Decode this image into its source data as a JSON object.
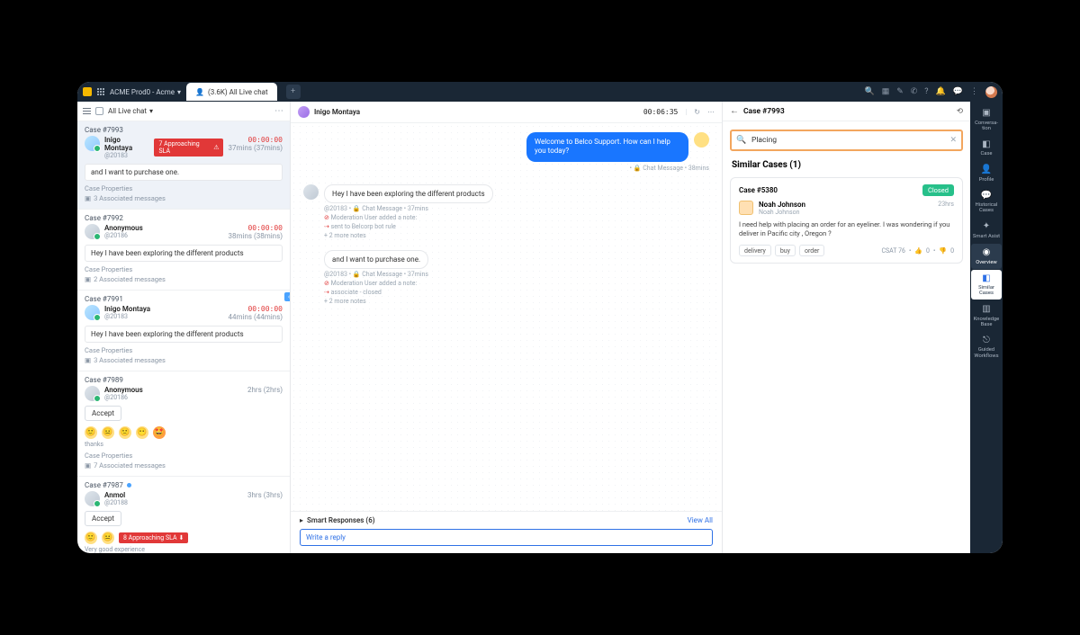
{
  "topbar": {
    "workspace": "ACME Prod0 - Acme",
    "tab_label": "(3.6K) All Live chat"
  },
  "list": {
    "title": "All Live chat",
    "cases": [
      {
        "id": "Case #7993",
        "name": "Inigo Montaya",
        "handle": "@20183",
        "sla": "7 Approaching SLA",
        "timer": "00:00:00",
        "time": "37mins (37mins)",
        "preview": "and I want to purchase one.",
        "props": "Case Properties",
        "assoc": "3 Associated messages"
      },
      {
        "id": "Case #7992",
        "name": "Anonymous",
        "handle": "@20186",
        "timer": "00:00:00",
        "time": "38mins (38mins)",
        "preview": "Hey I have been exploring the different products",
        "props": "Case Properties",
        "assoc": "2 Associated messages"
      },
      {
        "id": "Case #7991",
        "name": "Inigo Montaya",
        "handle": "@20183",
        "timer": "00:00:00",
        "time": "44mins (44mins)",
        "preview": "Hey I have been exploring the different products",
        "props": "Case Properties",
        "assoc": "3 Associated messages"
      },
      {
        "id": "Case #7989",
        "name": "Anonymous",
        "handle": "@20186",
        "time": "2hrs (2hrs)",
        "accept": "Accept",
        "thanks": "thanks",
        "props": "Case Properties",
        "assoc": "7 Associated messages"
      },
      {
        "id": "Case #7987",
        "name": "Anmol",
        "handle": "@20188",
        "time": "3hrs (3hrs)",
        "accept": "Accept",
        "sla2": "8 Approaching SLA",
        "trail": "Very good experience"
      }
    ]
  },
  "chat": {
    "name": "Inigo Montaya",
    "timer": "00:06:35",
    "out": "Welcome to Belco Support. How can I help you today?",
    "out_meta": "• 🔒 Chat Message • 38mins",
    "in1": "Hey I have been exploring the different products",
    "in1_meta1": "@20183 • 🔒 Chat Message • 37mins",
    "in1_meta2": "Moderation User added a note:",
    "in1_meta3": "sent to Belcorp bot rule",
    "in1_more": "+ 2 more notes",
    "in2": "and I want to purchase one.",
    "in2_meta1": "@20183 • 🔒 Chat Message • 37mins",
    "in2_meta2": "Moderation User added a note:",
    "in2_meta3": "associate - closed",
    "in2_more": "+ 2 more notes",
    "smart": "Smart Responses (6)",
    "viewall": "View All",
    "reply": "Write a reply"
  },
  "side": {
    "title": "Case #7993",
    "search_value": "Placing",
    "similar_head": "Similar Cases (1)",
    "card": {
      "id": "Case #5380",
      "status": "Closed",
      "user": "Noah Johnson",
      "usersub": "Noah Johnson",
      "age": "23hrs",
      "body": "I need help with placing an order for an eyeliner. I was wondering if you deliver in Pacific city , Oregon ?",
      "tags": [
        "delivery",
        "buy",
        "order"
      ],
      "csat": "CSAT 76",
      "up": "0",
      "down": "0"
    }
  },
  "rail": [
    {
      "icon": "▣",
      "label": "Conversa-\ntion"
    },
    {
      "icon": "◧",
      "label": "Case"
    },
    {
      "icon": "👤",
      "label": "Profile"
    },
    {
      "icon": "💬",
      "label": "Historical\nCases"
    },
    {
      "icon": "✦",
      "label": "Smart Asist"
    },
    {
      "icon": "◉",
      "label": "Overview"
    },
    {
      "icon": "◧",
      "label": "Similar\nCases",
      "active": true
    },
    {
      "icon": "▥",
      "label": "Knowledge\nBase"
    },
    {
      "icon": "⎋",
      "label": "Guided\nWorkflows"
    }
  ]
}
